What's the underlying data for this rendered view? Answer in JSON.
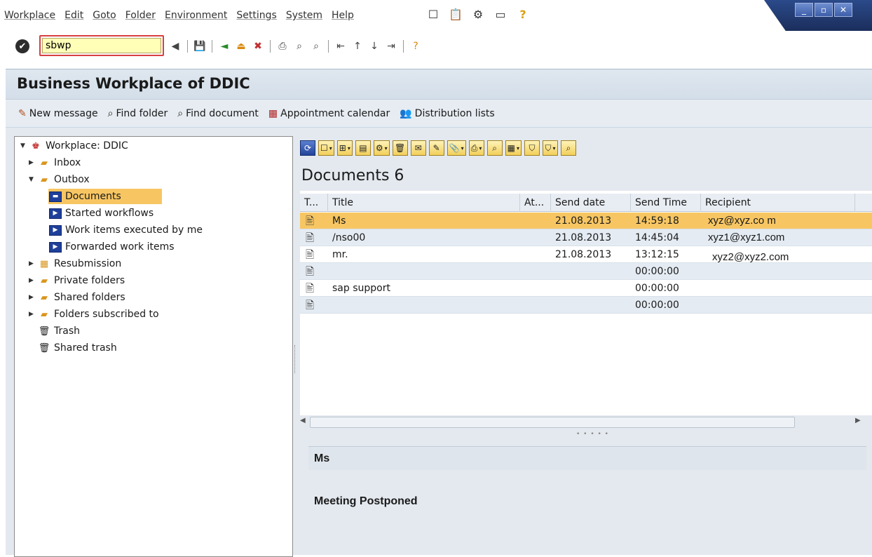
{
  "menubar": {
    "items": [
      "Workplace",
      "Edit",
      "Goto",
      "Folder",
      "Environment",
      "Settings",
      "System",
      "Help"
    ]
  },
  "command": {
    "value": "sbwp"
  },
  "header": {
    "title": "Business Workplace of DDIC"
  },
  "appbar": {
    "new_message": "New message",
    "find_folder": "Find folder",
    "find_document": "Find document",
    "appointment_calendar": "Appointment calendar",
    "distribution_lists": "Distribution lists"
  },
  "tree": {
    "root": "Workplace: DDIC",
    "inbox": "Inbox",
    "outbox": "Outbox",
    "documents": "Documents",
    "started_workflows": "Started workflows",
    "work_items_executed": "Work items executed by me",
    "forwarded_work_items": "Forwarded work items",
    "resubmission": "Resubmission",
    "private_folders": "Private folders",
    "shared_folders": "Shared folders",
    "folders_subscribed": "Folders subscribed to",
    "trash": "Trash",
    "shared_trash": "Shared trash"
  },
  "documents": {
    "title": "Documents 6",
    "columns": [
      "T...",
      "Title",
      "At...",
      "Send date",
      "Send Time",
      "Recipient"
    ],
    "rows": [
      {
        "title": "Ms",
        "send_date": "21.08.2013",
        "send_time": "14:59:18",
        "recipient": "xyz@xyz.co m"
      },
      {
        "title": "/nso00",
        "send_date": "21.08.2013",
        "send_time": "14:45:04",
        "recipient": "xyz1@xyz1.com"
      },
      {
        "title": "mr.",
        "send_date": "21.08.2013",
        "send_time": "13:12:15",
        "recipient": "xyz2@xyz2.com"
      },
      {
        "title": "",
        "send_date": "",
        "send_time": "00:00:00",
        "recipient": ""
      },
      {
        "title": "sap support",
        "send_date": "",
        "send_time": "00:00:00",
        "recipient": ""
      },
      {
        "title": "",
        "send_date": "",
        "send_time": "00:00:00",
        "recipient": ""
      }
    ]
  },
  "preview": {
    "subject": "Ms",
    "body": "Meeting Postponed"
  },
  "colors": {
    "selection": "#f7c663",
    "title_bg": "#dfe7ef",
    "field_bg": "#ffffb8"
  }
}
